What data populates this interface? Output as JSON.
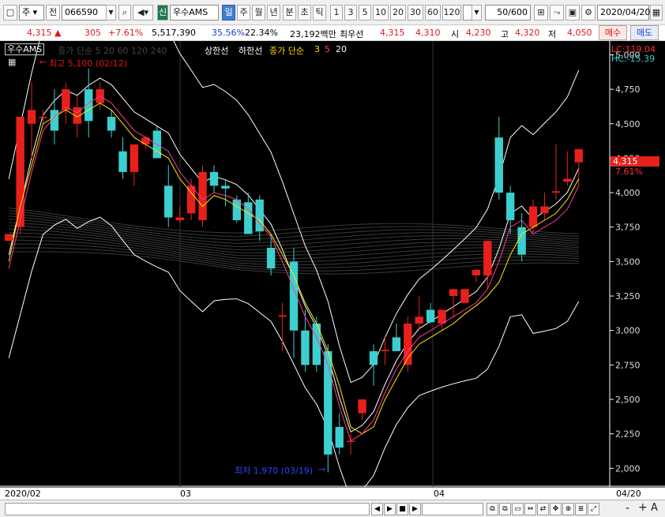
{
  "toolbar": {
    "period_type": "주",
    "prev_label": "전",
    "stock_code": "066590",
    "credit_badge": "신",
    "stock_name": "우수AMS",
    "tabs": [
      "일",
      "주",
      "월",
      "년",
      "분",
      "초",
      "틱"
    ],
    "active_tab": "일",
    "numbers": [
      "1",
      "3",
      "5",
      "10",
      "20",
      "30",
      "60",
      "120"
    ],
    "count_display": "50/600",
    "date": "2020/04/20"
  },
  "quote": {
    "price": "4,315",
    "change_arrow": "▲",
    "change": "305",
    "change_pct": "+7.61%",
    "volume": "5,517,390",
    "vol_ratio": "35.56%",
    "turnover": "22.34%",
    "amount": "23,192백만",
    "best_label": "최우선",
    "best_ask": "4,315",
    "best_bid": "4,310",
    "open_label": "시",
    "open": "4,230",
    "high_label": "고",
    "high": "4,320",
    "low_label": "저",
    "low": "4,050",
    "buy_label": "매수",
    "sell_label": "매도"
  },
  "chart_header": {
    "name": "우수AMS",
    "legend_gray": "종가 단순 5 20 60 120 240",
    "legend_upper": "상한선",
    "legend_lower": "하한선",
    "legend_ma": "종가 단순",
    "ma_5": "3",
    "ma_10": "5",
    "ma_20": "20",
    "lc": "LC:119.04",
    "hc": "HC:-15.39",
    "high_note": "최고 5,100 (02/12)",
    "low_note": "최저 1,970 (03/19)"
  },
  "price_tag": {
    "price": "4,315",
    "pct": "7.61%"
  },
  "chart_data": {
    "type": "candlestick",
    "y_ticks": [
      2000,
      2250,
      2500,
      2750,
      3000,
      3250,
      3500,
      3750,
      4000,
      4250,
      4500,
      4750,
      5000
    ],
    "y_tick_labels": [
      "2,000",
      "2,250",
      "2,500",
      "2,750",
      "3,000",
      "3,250",
      "3,500",
      "3,750",
      "4,000",
      "4,250",
      "4,500",
      "4,750",
      "5,000"
    ],
    "ylim": [
      1870,
      5100
    ],
    "x_labels": [
      "2020/02",
      "03",
      "04",
      "04/20"
    ],
    "up_color": "#e8201c",
    "down_color": "#3ccfcf",
    "candles": [
      {
        "o": 3650,
        "h": 3700,
        "c": 3700,
        "l": 3650
      },
      {
        "o": 3750,
        "h": 4530,
        "c": 4550,
        "l": 3700
      },
      {
        "o": 4500,
        "h": 4800,
        "c": 4600,
        "l": 4250
      },
      {
        "o": 4550,
        "h": 4600,
        "c": 4550,
        "l": 4500
      },
      {
        "o": 4600,
        "h": 4750,
        "c": 4450,
        "l": 4350
      },
      {
        "o": 4600,
        "h": 4800,
        "c": 4750,
        "l": 4500
      },
      {
        "o": 4500,
        "h": 4700,
        "c": 4620,
        "l": 4400
      },
      {
        "o": 4750,
        "h": 4900,
        "c": 4520,
        "l": 4400
      },
      {
        "o": 4650,
        "h": 4800,
        "c": 4750,
        "l": 4600
      },
      {
        "o": 4550,
        "h": 4600,
        "c": 4450,
        "l": 4400
      },
      {
        "o": 4300,
        "h": 4400,
        "c": 4150,
        "l": 4100
      },
      {
        "o": 4150,
        "h": 4350,
        "c": 4350,
        "l": 4050
      },
      {
        "o": 4350,
        "h": 4420,
        "c": 4400,
        "l": 4320
      },
      {
        "o": 4450,
        "h": 4480,
        "c": 4250,
        "l": 4250
      },
      {
        "o": 4050,
        "h": 4200,
        "c": 3820,
        "l": 3750
      },
      {
        "o": 3800,
        "h": 3900,
        "c": 3820,
        "l": 3780
      },
      {
        "o": 3850,
        "h": 4100,
        "c": 4050,
        "l": 3800
      },
      {
        "o": 3800,
        "h": 4200,
        "c": 4150,
        "l": 3750
      },
      {
        "o": 4150,
        "h": 4200,
        "c": 4050,
        "l": 4000
      },
      {
        "o": 4050,
        "h": 4100,
        "c": 4030,
        "l": 3900
      },
      {
        "o": 3950,
        "h": 3980,
        "c": 3800,
        "l": 3780
      },
      {
        "o": 3930,
        "h": 4000,
        "c": 3700,
        "l": 3700
      },
      {
        "o": 3950,
        "h": 3980,
        "c": 3720,
        "l": 3650
      },
      {
        "o": 3600,
        "h": 3700,
        "c": 3450,
        "l": 3400
      },
      {
        "o": 3100,
        "h": 3200,
        "c": 3110,
        "l": 2850
      },
      {
        "o": 3500,
        "h": 3600,
        "c": 3000,
        "l": 2800
      },
      {
        "o": 3000,
        "h": 3150,
        "c": 2750,
        "l": 2700
      },
      {
        "o": 3050,
        "h": 3100,
        "c": 2750,
        "l": 2700
      },
      {
        "o": 2850,
        "h": 2900,
        "c": 2100,
        "l": 1970
      },
      {
        "o": 2300,
        "h": 2400,
        "c": 2150,
        "l": 2100
      },
      {
        "o": 2200,
        "h": 2250,
        "c": 2200,
        "l": 2100
      },
      {
        "o": 2400,
        "h": 2500,
        "c": 2500,
        "l": 2350
      },
      {
        "o": 2850,
        "h": 2900,
        "c": 2750,
        "l": 2600
      },
      {
        "o": 2850,
        "h": 2950,
        "c": 2860,
        "l": 2750
      },
      {
        "o": 2950,
        "h": 3050,
        "c": 2850,
        "l": 2850
      },
      {
        "o": 2750,
        "h": 3100,
        "c": 3050,
        "l": 2700
      },
      {
        "o": 3050,
        "h": 3250,
        "c": 3100,
        "l": 3000
      },
      {
        "o": 3150,
        "h": 3200,
        "c": 3060,
        "l": 3050
      },
      {
        "o": 3050,
        "h": 3150,
        "c": 3150,
        "l": 3000
      },
      {
        "o": 3250,
        "h": 3300,
        "c": 3300,
        "l": 3100
      },
      {
        "o": 3200,
        "h": 3300,
        "c": 3300,
        "l": 3200
      },
      {
        "o": 3400,
        "h": 3450,
        "c": 3440,
        "l": 3350
      },
      {
        "o": 3400,
        "h": 3650,
        "c": 3650,
        "l": 3300
      },
      {
        "o": 4400,
        "h": 4550,
        "c": 4000,
        "l": 3950
      },
      {
        "o": 4000,
        "h": 4050,
        "c": 3800,
        "l": 3700
      },
      {
        "o": 3750,
        "h": 3850,
        "c": 3550,
        "l": 3500
      },
      {
        "o": 3750,
        "h": 3950,
        "c": 3900,
        "l": 3700
      },
      {
        "o": 3850,
        "h": 4000,
        "c": 3900,
        "l": 3800
      },
      {
        "o": 4000,
        "h": 4350,
        "c": 4010,
        "l": 3950
      },
      {
        "o": 4080,
        "h": 4300,
        "c": 4100,
        "l": 4050
      },
      {
        "o": 4220,
        "h": 4320,
        "c": 4315,
        "l": 4050
      }
    ],
    "ma5": [
      3500,
      3900,
      4200,
      4500,
      4550,
      4600,
      4550,
      4600,
      4650,
      4600,
      4500,
      4400,
      4350,
      4300,
      4250,
      4100,
      4000,
      3900,
      3980,
      3950,
      3900,
      3850,
      3800,
      3700,
      3550,
      3400,
      3200,
      3050,
      2850,
      2600,
      2300,
      2250,
      2300,
      2500,
      2650,
      2800,
      2900,
      2950,
      3000,
      3050,
      3120,
      3180,
      3250,
      3350,
      3550,
      3700,
      3750,
      3800,
      3850,
      3950,
      4100
    ],
    "ma20": [
      3450,
      3800,
      4150,
      4450,
      4550,
      4620,
      4580,
      4650,
      4700,
      4650,
      4550,
      4450,
      4400,
      4350,
      4300,
      4150,
      4050,
      3950,
      4000,
      3980,
      3950,
      3880,
      3780,
      3680,
      3500,
      3300,
      3100,
      2950,
      2750,
      2450,
      2200,
      2250,
      2350,
      2550,
      2720,
      2850,
      2950,
      3000,
      3050,
      3100,
      3150,
      3200,
      3300,
      3500,
      3750,
      3800,
      3700,
      3750,
      3800,
      3880,
      4050
    ]
  },
  "scrollbar": {
    "controls": [
      "◀",
      "▶",
      "■",
      "▶"
    ],
    "zoom": [
      "-",
      "+",
      "A"
    ]
  }
}
